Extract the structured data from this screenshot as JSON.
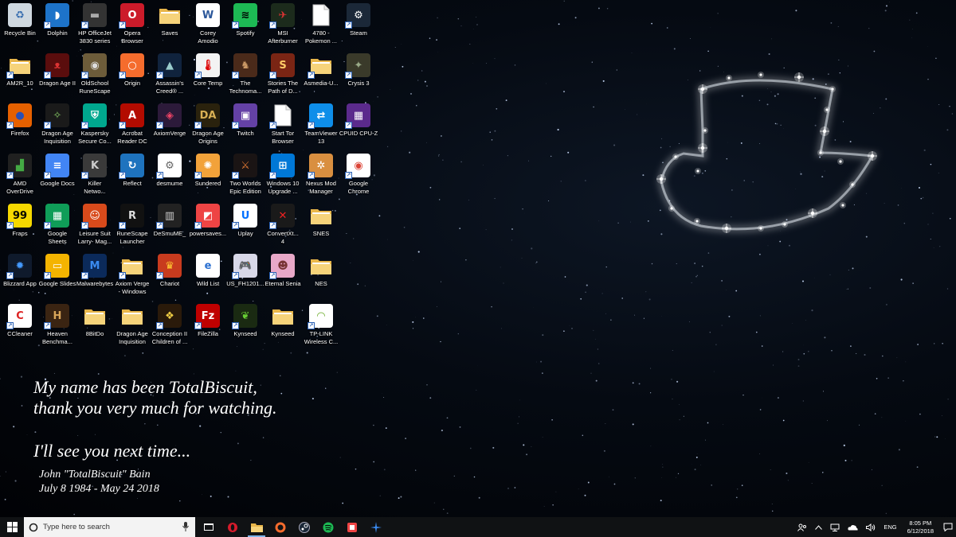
{
  "desktop": {
    "icons": [
      {
        "label": "Recycle Bin",
        "icon": "recycle-bin-icon",
        "bg": "#cfd8e0",
        "glyph": "♻",
        "fg": "#3a6fb0",
        "shortcut": false
      },
      {
        "label": "Dolphin",
        "icon": "dolphin-icon",
        "bg": "#1d73c9",
        "glyph": "◗",
        "fg": "#fff",
        "shortcut": true
      },
      {
        "label": "HP OfficeJet\n3830 series",
        "icon": "printer-icon",
        "bg": "#333",
        "glyph": "▬",
        "fg": "#aaa",
        "shortcut": true
      },
      {
        "label": "Opera\nBrowser",
        "icon": "opera-icon",
        "bg": "#cc1b2a",
        "glyph": "O",
        "fg": "#fff",
        "shortcut": true
      },
      {
        "label": "Saves",
        "icon": "folder-icon",
        "bg": "#f2cf67",
        "glyph": "",
        "fg": "#fff",
        "shortcut": false
      },
      {
        "label": "Corey\nAmodio",
        "icon": "word-document-icon",
        "bg": "#ffffff",
        "glyph": "W",
        "fg": "#2b579a",
        "shortcut": false
      },
      {
        "label": "Spotify",
        "icon": "spotify-icon",
        "bg": "#1db954",
        "glyph": "≋",
        "fg": "#000",
        "shortcut": true
      },
      {
        "label": "MSI\nAfterburner",
        "icon": "msi-afterburner-icon",
        "bg": "#1c2b1c",
        "glyph": "✈",
        "fg": "#d33",
        "shortcut": true
      },
      {
        "label": "4780 -\nPokemon ...",
        "icon": "file-icon",
        "bg": "#ffffff",
        "glyph": "",
        "fg": "#999",
        "shortcut": false
      },
      {
        "label": "Steam",
        "icon": "steam-icon",
        "bg": "#1b2838",
        "glyph": "⚙",
        "fg": "#fff",
        "shortcut": true
      },
      {
        "label": "AM2R_10",
        "icon": "folder-icon",
        "bg": "#f2cf67",
        "glyph": "",
        "fg": "#fff",
        "shortcut": true
      },
      {
        "label": "Dragon Age II",
        "icon": "dragon-age-2-icon",
        "bg": "#5a0d0d",
        "glyph": "ᴥ",
        "fg": "#d33",
        "shortcut": true
      },
      {
        "label": "OldSchool\nRuneScape",
        "icon": "runescape-icon",
        "bg": "#6d5c3a",
        "glyph": "◉",
        "fg": "#ddd",
        "shortcut": true
      },
      {
        "label": "Origin",
        "icon": "origin-icon",
        "bg": "#f56c2d",
        "glyph": "○",
        "fg": "#fff",
        "shortcut": true
      },
      {
        "label": "Assassin's\nCreed® ...",
        "icon": "assassins-creed-icon",
        "bg": "#10233d",
        "glyph": "▲",
        "fg": "#9cc",
        "shortcut": true
      },
      {
        "label": "Core Temp",
        "icon": "core-temp-icon",
        "bg": "#f3f3f3",
        "glyph": "🌡",
        "fg": "#d00",
        "shortcut": true
      },
      {
        "label": "The\nTechnoma...",
        "icon": "technomancer-icon",
        "bg": "#4a2a1a",
        "glyph": "♞",
        "fg": "#c96",
        "shortcut": true
      },
      {
        "label": "Stories The\nPath of D...",
        "icon": "stories-icon",
        "bg": "#7a2514",
        "glyph": "S",
        "fg": "#fc6",
        "shortcut": true
      },
      {
        "label": "Asmedia-U...",
        "icon": "folder-icon",
        "bg": "#f2cf67",
        "glyph": "",
        "fg": "#fff",
        "shortcut": true
      },
      {
        "label": "Crysis 3",
        "icon": "crysis-icon",
        "bg": "#3a3a2a",
        "glyph": "✦",
        "fg": "#9a8",
        "shortcut": true
      },
      {
        "label": "Firefox",
        "icon": "firefox-icon",
        "bg": "#e66000",
        "glyph": "●",
        "fg": "#2a4fb5",
        "shortcut": true
      },
      {
        "label": "Dragon Age\nInquisition",
        "icon": "dragon-age-inquisition-icon",
        "bg": "#1a1a1a",
        "glyph": "✧",
        "fg": "#8c6",
        "shortcut": true
      },
      {
        "label": "Kaspersky\nSecure Co...",
        "icon": "kaspersky-icon",
        "bg": "#00a88e",
        "glyph": "⛨",
        "fg": "#fff",
        "shortcut": true
      },
      {
        "label": "Acrobat\nReader DC",
        "icon": "acrobat-icon",
        "bg": "#b30b00",
        "glyph": "A",
        "fg": "#fff",
        "shortcut": true
      },
      {
        "label": "AxiomVerge",
        "icon": "axiom-verge-icon",
        "bg": "#2c1a3a",
        "glyph": "◈",
        "fg": "#e46",
        "shortcut": true
      },
      {
        "label": "Dragon Age\nOrigins",
        "icon": "dragon-age-origins-icon",
        "bg": "#2a220d",
        "glyph": "DA",
        "fg": "#d9b054",
        "shortcut": true
      },
      {
        "label": "Twitch",
        "icon": "twitch-icon",
        "bg": "#6441a5",
        "glyph": "▣",
        "fg": "#fff",
        "shortcut": true
      },
      {
        "label": "Start Tor\nBrowser",
        "icon": "file-icon",
        "bg": "#ffffff",
        "glyph": "",
        "fg": "#999",
        "shortcut": true
      },
      {
        "label": "TeamViewer\n13",
        "icon": "teamviewer-icon",
        "bg": "#0e8ee9",
        "glyph": "⇄",
        "fg": "#fff",
        "shortcut": true
      },
      {
        "label": "CPUID CPU-Z",
        "icon": "cpuz-icon",
        "bg": "#5b2a8c",
        "glyph": "▦",
        "fg": "#fff",
        "shortcut": true
      },
      {
        "label": "AMD\nOverDrive",
        "icon": "amd-overdrive-icon",
        "bg": "#202020",
        "glyph": "▟",
        "fg": "#4a4",
        "shortcut": true
      },
      {
        "label": "Google Docs",
        "icon": "google-docs-icon",
        "bg": "#4285f4",
        "glyph": "≡",
        "fg": "#fff",
        "shortcut": true
      },
      {
        "label": "Killer\nNetwo...",
        "icon": "killer-network-icon",
        "bg": "#3a3a3a",
        "glyph": "K",
        "fg": "#ccc",
        "shortcut": true
      },
      {
        "label": "Reflect",
        "icon": "reflect-icon",
        "bg": "#1e73be",
        "glyph": "↻",
        "fg": "#fff",
        "shortcut": true
      },
      {
        "label": "desmume",
        "icon": "settings-file-icon",
        "bg": "#ffffff",
        "glyph": "⚙",
        "fg": "#666",
        "shortcut": true
      },
      {
        "label": "Sundered",
        "icon": "sundered-icon",
        "bg": "#f2a23a",
        "glyph": "✺",
        "fg": "#fff",
        "shortcut": true
      },
      {
        "label": "Two Worlds\nEpic Edition",
        "icon": "two-worlds-icon",
        "bg": "#1a1414",
        "glyph": "⚔",
        "fg": "#d73",
        "shortcut": true
      },
      {
        "label": "Windows 10\nUpgrade ...",
        "icon": "windows-icon",
        "bg": "#0078d7",
        "glyph": "⊞",
        "fg": "#fff",
        "shortcut": true
      },
      {
        "label": "Nexus Mod\nManager",
        "icon": "nexus-mod-icon",
        "bg": "#d98f40",
        "glyph": "✲",
        "fg": "#fff",
        "shortcut": true
      },
      {
        "label": "Google\nChrome",
        "icon": "chrome-icon",
        "bg": "#ffffff",
        "glyph": "◉",
        "fg": "#db4437",
        "shortcut": true
      },
      {
        "label": "Fraps",
        "icon": "fraps-icon",
        "bg": "#f6d800",
        "glyph": "99",
        "fg": "#000",
        "shortcut": true
      },
      {
        "label": "Google\nSheets",
        "icon": "google-sheets-icon",
        "bg": "#0f9d58",
        "glyph": "▦",
        "fg": "#fff",
        "shortcut": true
      },
      {
        "label": "Leisure Suit\nLarry- Mag...",
        "icon": "leisure-suit-larry-icon",
        "bg": "#d84a1b",
        "glyph": "☺",
        "fg": "#fff",
        "shortcut": true
      },
      {
        "label": "RuneScape\nLauncher",
        "icon": "runescape-launcher-icon",
        "bg": "#111",
        "glyph": "R",
        "fg": "#ddd",
        "shortcut": true
      },
      {
        "label": "DeSmuME_",
        "icon": "desmume-icon",
        "bg": "#222",
        "glyph": "▥",
        "fg": "#ccc",
        "shortcut": true
      },
      {
        "label": "powersaves...",
        "icon": "powersaves-icon",
        "bg": "#e44",
        "glyph": "◩",
        "fg": "#fff",
        "shortcut": true
      },
      {
        "label": "Uplay",
        "icon": "uplay-icon",
        "bg": "#ffffff",
        "glyph": "U",
        "fg": "#0070ff",
        "shortcut": true
      },
      {
        "label": "ConvertXt...\n4",
        "icon": "convertxtodvd-icon",
        "bg": "#1a1a1a",
        "glyph": "✕",
        "fg": "#e22",
        "shortcut": true
      },
      {
        "label": "SNES",
        "icon": "folder-icon",
        "bg": "#f2cf67",
        "glyph": "",
        "fg": "#fff",
        "shortcut": false
      },
      {
        "label": "",
        "icon": "",
        "bg": "",
        "glyph": "",
        "fg": "",
        "shortcut": false
      },
      {
        "label": "Blizzard App",
        "icon": "blizzard-icon",
        "bg": "#0f1a2c",
        "glyph": "✹",
        "fg": "#49f",
        "shortcut": true
      },
      {
        "label": "Google Slides",
        "icon": "google-slides-icon",
        "bg": "#f4b400",
        "glyph": "▭",
        "fg": "#fff",
        "shortcut": true
      },
      {
        "label": "Malwarebytes",
        "icon": "malwarebytes-icon",
        "bg": "#0b2a5a",
        "glyph": "M",
        "fg": "#3a8bf0",
        "shortcut": true
      },
      {
        "label": "Axiom Verge\n- Windows",
        "icon": "folder-icon",
        "bg": "#f2cf67",
        "glyph": "",
        "fg": "#fff",
        "shortcut": true
      },
      {
        "label": "Chariot",
        "icon": "chariot-icon",
        "bg": "#c83b1e",
        "glyph": "♛",
        "fg": "#fc3",
        "shortcut": true
      },
      {
        "label": "Wild List",
        "icon": "pdf-icon",
        "bg": "#ffffff",
        "glyph": "e",
        "fg": "#2a6fd0",
        "shortcut": false
      },
      {
        "label": "US_FH1201...",
        "icon": "gamepad-icon",
        "bg": "#d8d8e8",
        "glyph": "🎮",
        "fg": "#555",
        "shortcut": true
      },
      {
        "label": "Eternal Senia",
        "icon": "eternal-senia-icon",
        "bg": "#e8a8c8",
        "glyph": "☻",
        "fg": "#733",
        "shortcut": true
      },
      {
        "label": "NES",
        "icon": "folder-icon",
        "bg": "#f2cf67",
        "glyph": "",
        "fg": "#fff",
        "shortcut": false
      },
      {
        "label": "",
        "icon": "",
        "bg": "",
        "glyph": "",
        "fg": "",
        "shortcut": false
      },
      {
        "label": "CCleaner",
        "icon": "ccleaner-icon",
        "bg": "#ffffff",
        "glyph": "C",
        "fg": "#d22",
        "shortcut": true
      },
      {
        "label": "Heaven\nBenchma...",
        "icon": "heaven-benchmark-icon",
        "bg": "#3a2412",
        "glyph": "H",
        "fg": "#d9a65a",
        "shortcut": true
      },
      {
        "label": "8BitDo",
        "icon": "folder-icon",
        "bg": "#f2cf67",
        "glyph": "",
        "fg": "#fff",
        "shortcut": false
      },
      {
        "label": "Dragon Age\nInquisition",
        "icon": "folder-icon",
        "bg": "#f2cf67",
        "glyph": "",
        "fg": "#fff",
        "shortcut": false
      },
      {
        "label": "Conception II\nChildren of ...",
        "icon": "conception-icon",
        "bg": "#2a1a0a",
        "glyph": "❖",
        "fg": "#ec4",
        "shortcut": true
      },
      {
        "label": "FileZilla",
        "icon": "filezilla-icon",
        "bg": "#bf0000",
        "glyph": "Fz",
        "fg": "#fff",
        "shortcut": true
      },
      {
        "label": "Kynseed",
        "icon": "kynseed-icon",
        "bg": "#1a2a12",
        "glyph": "❦",
        "fg": "#6c3",
        "shortcut": true
      },
      {
        "label": "Kynseed",
        "icon": "folder-icon",
        "bg": "#f2cf67",
        "glyph": "",
        "fg": "#fff",
        "shortcut": false
      },
      {
        "label": "TP-LINK\nWireless C...",
        "icon": "tp-link-wireless-icon",
        "bg": "#ffffff",
        "glyph": "◠",
        "fg": "#6a2",
        "shortcut": true
      },
      {
        "label": "",
        "icon": "",
        "bg": "",
        "glyph": "",
        "fg": "",
        "shortcut": false
      }
    ]
  },
  "tribute": {
    "line1": "My name has been TotalBiscuit,",
    "line2": "thank you very much for watching.",
    "line3": "I'll see you next time...",
    "name": "John \"TotalBiscuit\" Bain",
    "dates": "July 8 1984 - May 24 2018"
  },
  "taskbar": {
    "search_placeholder": "Type here to search",
    "pinned": [
      {
        "icon": "task-view-icon",
        "active": false
      },
      {
        "icon": "opera-icon",
        "active": false
      },
      {
        "icon": "file-explorer-icon",
        "active": true
      },
      {
        "icon": "origin-icon",
        "active": false
      },
      {
        "icon": "steam-icon",
        "active": false
      },
      {
        "icon": "spotify-icon",
        "active": false
      },
      {
        "icon": "powersaves-icon",
        "active": false
      },
      {
        "icon": "blizzard-icon",
        "active": false
      }
    ],
    "tray": {
      "language": "ENG",
      "time": "8:05 PM",
      "date": "6/12/2018"
    }
  },
  "colors": {
    "taskbar_bg": "#101214",
    "accent": "#7eb4ea",
    "text": "#ffffff"
  }
}
